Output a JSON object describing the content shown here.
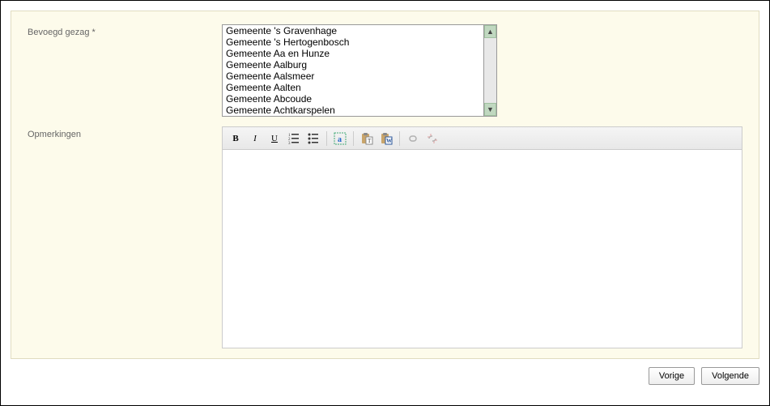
{
  "fields": {
    "bevoegd_gezag": {
      "label": "Bevoegd gezag *",
      "options": [
        "Gemeente 's Gravenhage",
        "Gemeente 's Hertogenbosch",
        "Gemeente Aa en Hunze",
        "Gemeente Aalburg",
        "Gemeente Aalsmeer",
        "Gemeente Aalten",
        "Gemeente Abcoude",
        "Gemeente Achtkarspelen"
      ]
    },
    "opmerkingen": {
      "label": "Opmerkingen",
      "value": ""
    }
  },
  "toolbar": {
    "bold": "B",
    "italic": "I",
    "underline": "U"
  },
  "buttons": {
    "prev": "Vorige",
    "next": "Volgende"
  }
}
